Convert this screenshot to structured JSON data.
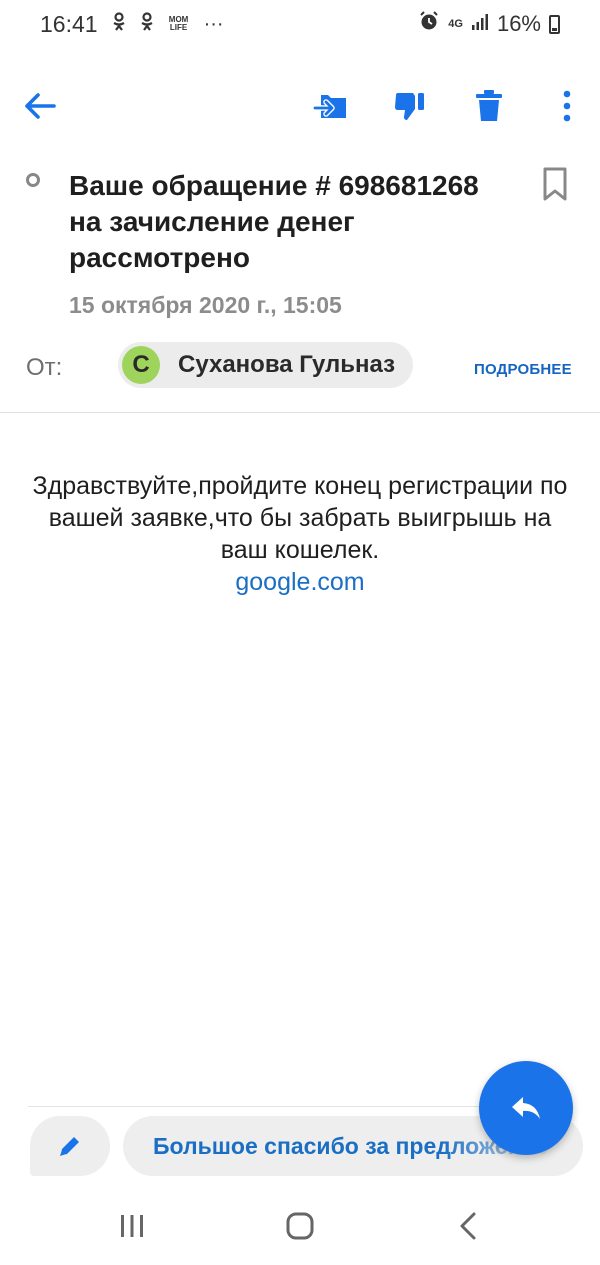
{
  "status_bar": {
    "time": "16:41",
    "notif_1": "ꔹ",
    "notif_2": "ꔹ",
    "notif_3": "MOM LIFE",
    "more": "···",
    "network": "4G",
    "battery": "16%"
  },
  "toolbar": {
    "back": "back-arrow-icon",
    "move": "move-to-folder-icon",
    "spam": "spam-thumb-down-icon",
    "delete": "trash-icon",
    "more": "more-vertical-icon"
  },
  "message": {
    "subject": "Ваше обращение # 698681268 на зачисление денег рассмотрено",
    "date": "15 октября 2020 г., 15:05",
    "from_label": "От:",
    "sender_initial": "С",
    "sender_name": "Суханова Гульназ",
    "details_label": "ПОДРОБНЕЕ",
    "body": "Здравствуйте,пройдите конец регистрации по вашей заявке,что бы забрать выигрышь на ваш кошелек.",
    "link": "google.com"
  },
  "quick_reply": {
    "text": "Большое спасибо за предложение"
  },
  "colors": {
    "accent": "#1a73e8",
    "avatar": "#9ed35c",
    "link": "#1a6fc4"
  }
}
